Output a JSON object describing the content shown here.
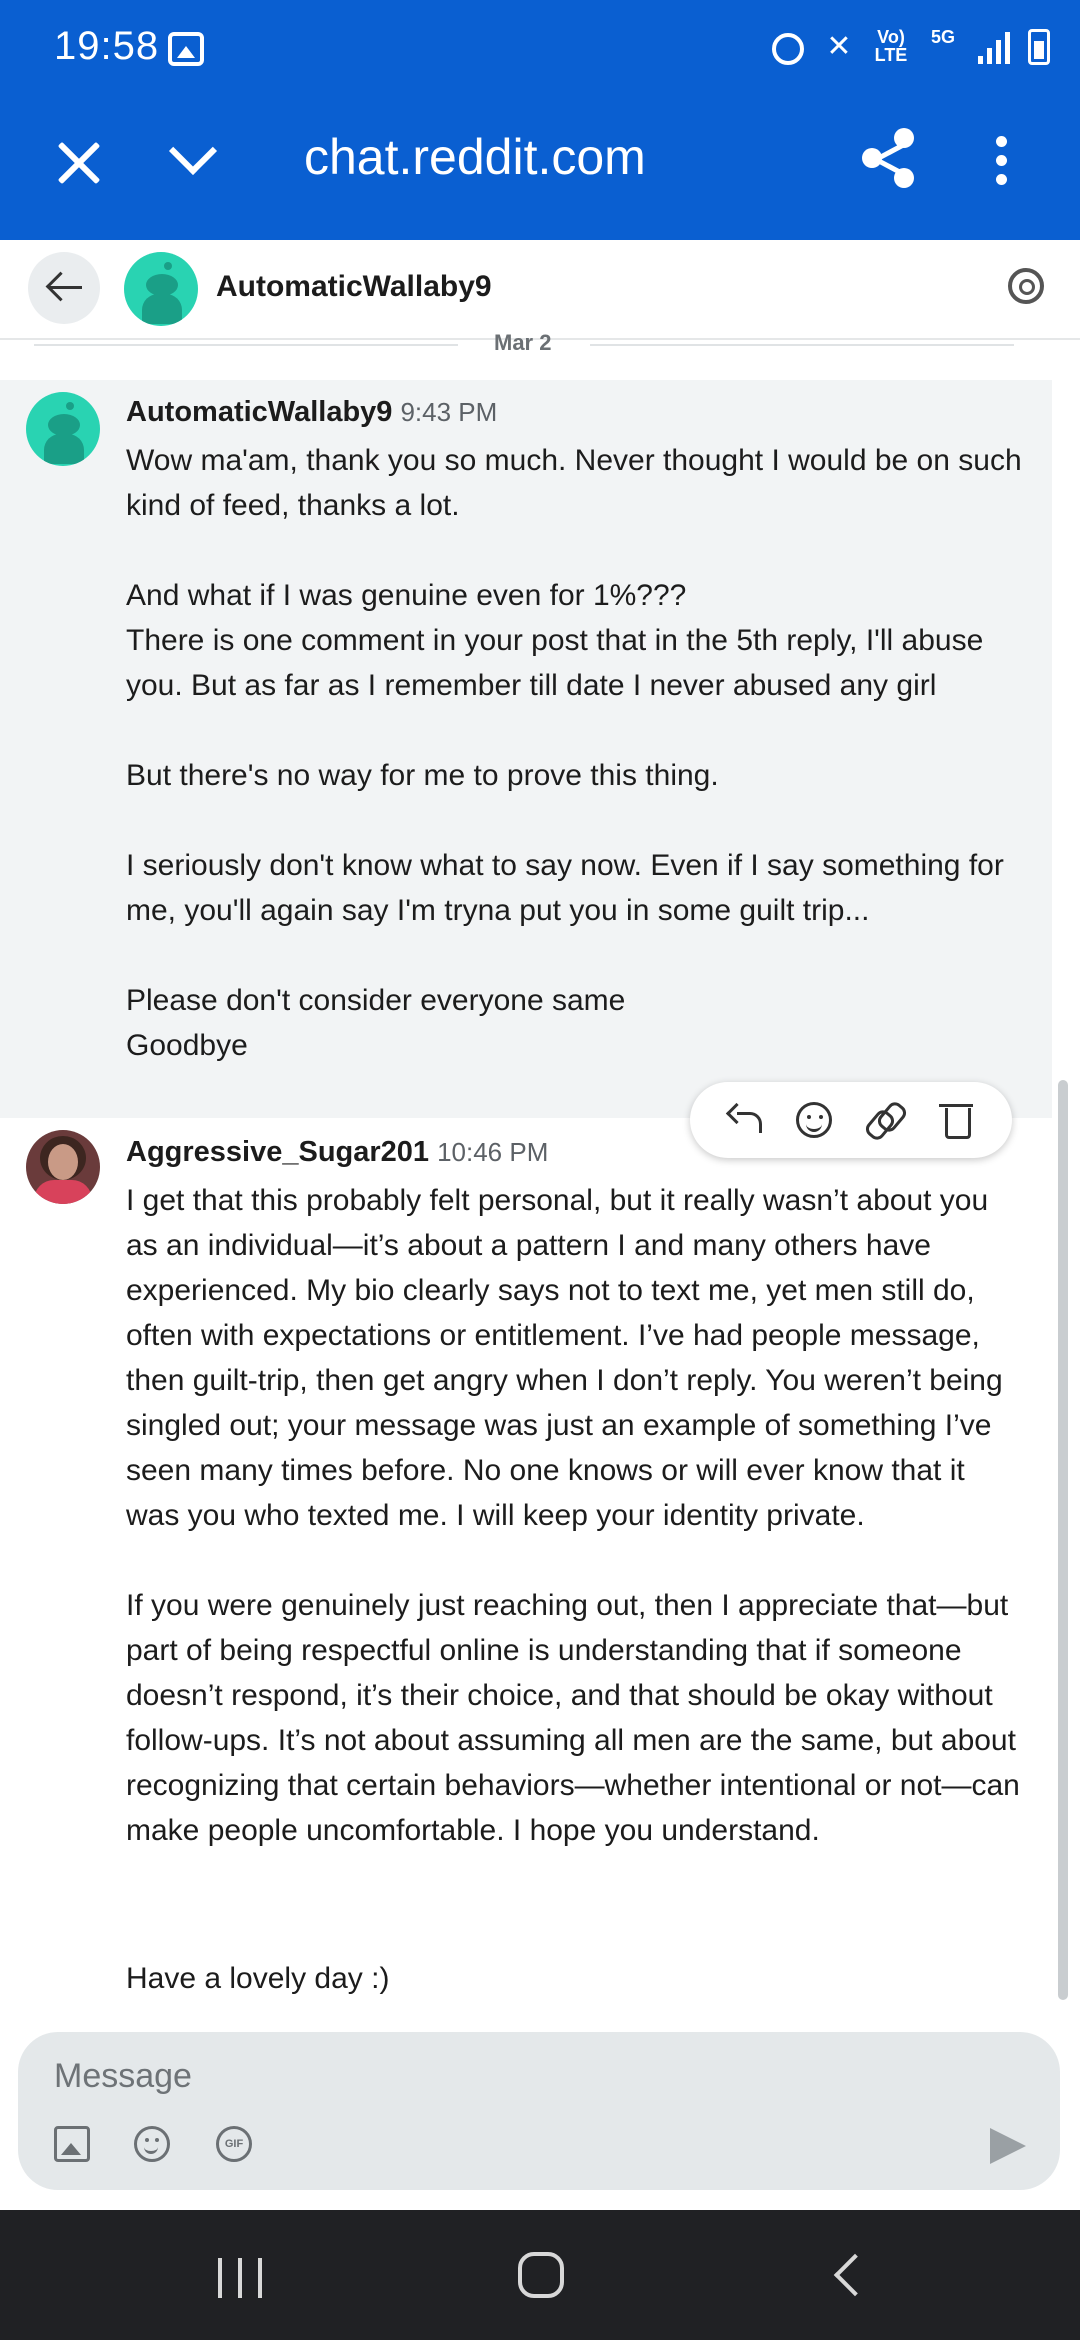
{
  "status_bar": {
    "time": "19:58",
    "icons": [
      "gallery-icon",
      "alarm-icon",
      "mute-icon",
      "volte-icon",
      "5g-icon",
      "signal-icon",
      "battery-icon"
    ],
    "volte_label": "Vo) LTE",
    "network_label": "5G"
  },
  "browser": {
    "url": "chat.reddit.com",
    "accent_color": "#0a5fd1"
  },
  "chat_header": {
    "name": "AutomaticWallaby9"
  },
  "divider": {
    "date": "Mar 2"
  },
  "messages": [
    {
      "author": "AutomaticWallaby9",
      "time": "9:43 PM",
      "text": "Wow ma'am, thank you so much. Never thought I would be on such kind of feed, thanks a lot.\n\nAnd what if I was genuine even for 1%???\nThere is one comment in your post that in the 5th reply, I'll abuse you. But as far as I remember till date I never abused any girl\n\nBut there's no way for me to prove this thing.\n\nI seriously don't know what to say now. Even if I say something for me, you'll again say I'm tryna put you in some guilt trip...\n\nPlease don't consider everyone same\nGoodbye"
    },
    {
      "author": "Aggressive_Sugar201",
      "time": "10:46 PM",
      "text": "I get that this probably felt personal, but it really wasn’t about you as an individual—it’s about a pattern I and many others have experienced. My bio clearly says not to text me, yet men still do, often with expectations or entitlement. I’ve had people message, then guilt-trip, then get angry when I don’t reply. You weren’t being singled out; your message was just an example of something I’ve seen many times before. No one knows or will ever know that it was you who texted me. I will keep your identity private.\n\nIf you were genuinely just reaching out, then I appreciate that—but part of being respectful online is understanding that if someone doesn’t respond, it’s their choice, and that should be okay without follow-ups. It’s not about assuming all men are the same, but about recognizing that certain behaviors—whether intentional or not—can make people uncomfortable. I hope you understand.",
      "closing": "Have a lovely day :)"
    }
  ],
  "composer": {
    "placeholder": "Message",
    "gif_label": "GIF"
  }
}
